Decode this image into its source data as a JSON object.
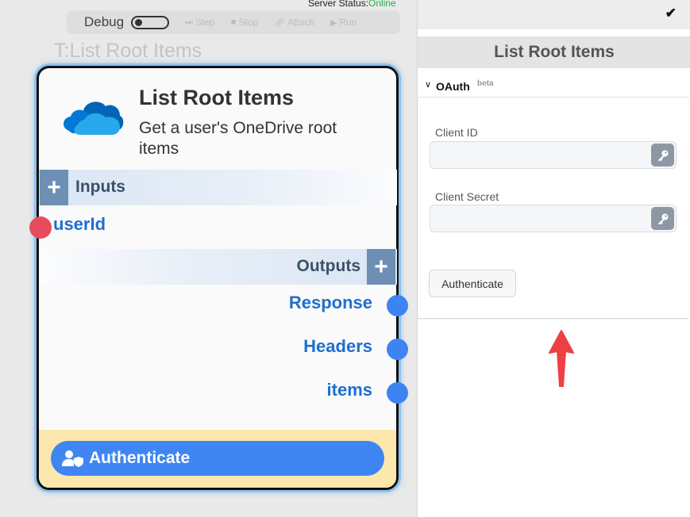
{
  "server_status": {
    "label": "Server Status:",
    "value": "Online"
  },
  "toolbar": {
    "debug_label": "Debug",
    "buttons": [
      {
        "label": "Step",
        "icon": "step-icon"
      },
      {
        "label": "Stop",
        "icon": "stop-icon"
      },
      {
        "label": "Attach",
        "icon": "link-icon"
      },
      {
        "label": "Run",
        "icon": "play-icon"
      }
    ]
  },
  "canvas": {
    "node_ghost_title": "T:List Root Items"
  },
  "node": {
    "name": "List Root Items",
    "description": "Get a user's OneDrive root items",
    "icon": "onedrive-cloud-icon",
    "inputs_label": "Inputs",
    "inputs": [
      "userId"
    ],
    "outputs_label": "Outputs",
    "outputs": [
      "Response",
      "Headers",
      "items"
    ],
    "authenticate_label": "Authenticate",
    "colors": {
      "input_port": "#e74c5c",
      "output_port": "#3b84f1",
      "footer": "#fde7ad",
      "auth_button": "#3f86f2"
    }
  },
  "panel": {
    "title": "List Root Items",
    "section": {
      "title": "OAuth",
      "badge": "beta"
    },
    "client_id_label": "Client ID",
    "client_id_value": "",
    "client_secret_label": "Client Secret",
    "client_secret_value": "",
    "authenticate_label": "Authenticate"
  },
  "annotation": {
    "arrow_color": "#ee3f45"
  }
}
